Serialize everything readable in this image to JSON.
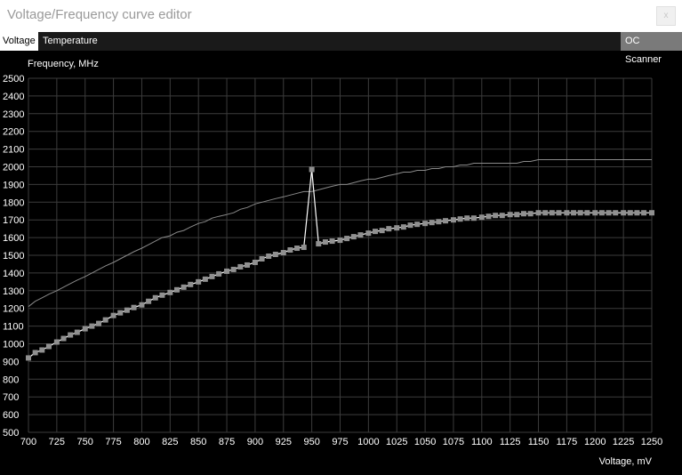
{
  "window": {
    "title": "Voltage/Frequency curve editor",
    "close_glyph": "x"
  },
  "tabs": {
    "voltage": "Voltage",
    "temperature": "Temperature",
    "oc_scanner": "OC Scanner"
  },
  "colors": {
    "background": "#000000",
    "grid": "#3c3c3c",
    "curve": "#ffffff",
    "reference_curve": "#8a8a8a",
    "point": "#909090"
  },
  "chart_data": {
    "type": "line",
    "ylabel": "Frequency, MHz",
    "xlabel": "Voltage, mV",
    "xlim": [
      700,
      1250
    ],
    "ylim": [
      500,
      2500
    ],
    "xticks": [
      700,
      725,
      750,
      775,
      800,
      825,
      850,
      875,
      900,
      925,
      950,
      975,
      1000,
      1025,
      1050,
      1075,
      1100,
      1125,
      1150,
      1175,
      1200,
      1225,
      1250
    ],
    "yticks": [
      500,
      600,
      700,
      800,
      900,
      1000,
      1100,
      1200,
      1300,
      1400,
      1500,
      1600,
      1700,
      1800,
      1900,
      2000,
      2100,
      2200,
      2300,
      2400,
      2500
    ],
    "grid": true,
    "series": [
      {
        "role": "reference",
        "x": [
          700,
          706,
          712,
          718,
          725,
          731,
          737,
          743,
          750,
          756,
          762,
          768,
          775,
          781,
          787,
          793,
          800,
          806,
          812,
          818,
          825,
          831,
          837,
          843,
          850,
          856,
          862,
          868,
          875,
          881,
          887,
          893,
          900,
          906,
          912,
          918,
          925,
          931,
          937,
          943,
          950,
          956,
          962,
          968,
          975,
          981,
          987,
          993,
          1000,
          1006,
          1012,
          1018,
          1025,
          1031,
          1037,
          1043,
          1050,
          1056,
          1062,
          1068,
          1075,
          1081,
          1087,
          1093,
          1100,
          1106,
          1112,
          1118,
          1125,
          1131,
          1137,
          1143,
          1150,
          1156,
          1162,
          1168,
          1175,
          1181,
          1187,
          1193,
          1200,
          1206,
          1212,
          1218,
          1225,
          1231,
          1237,
          1243,
          1250
        ],
        "y": [
          1210,
          1240,
          1260,
          1280,
          1300,
          1320,
          1340,
          1360,
          1380,
          1400,
          1420,
          1440,
          1460,
          1480,
          1500,
          1520,
          1540,
          1560,
          1580,
          1600,
          1610,
          1630,
          1640,
          1660,
          1680,
          1690,
          1710,
          1720,
          1730,
          1740,
          1760,
          1770,
          1790,
          1800,
          1810,
          1820,
          1830,
          1840,
          1850,
          1860,
          1860,
          1870,
          1880,
          1890,
          1900,
          1900,
          1910,
          1920,
          1930,
          1930,
          1940,
          1950,
          1960,
          1970,
          1970,
          1980,
          1980,
          1990,
          1990,
          2000,
          2000,
          2010,
          2010,
          2020,
          2020,
          2020,
          2020,
          2020,
          2020,
          2020,
          2030,
          2030,
          2040,
          2040,
          2040,
          2040,
          2040,
          2040,
          2040,
          2040,
          2040,
          2040,
          2040,
          2040,
          2040,
          2040,
          2040,
          2040,
          2040
        ]
      },
      {
        "role": "curve",
        "x": [
          700,
          706,
          712,
          718,
          725,
          731,
          737,
          743,
          750,
          756,
          762,
          768,
          775,
          781,
          787,
          793,
          800,
          806,
          812,
          818,
          825,
          831,
          837,
          843,
          850,
          856,
          862,
          868,
          875,
          881,
          887,
          893,
          900,
          906,
          912,
          918,
          925,
          931,
          937,
          943,
          950,
          956,
          962,
          968,
          975,
          981,
          987,
          993,
          1000,
          1006,
          1012,
          1018,
          1025,
          1031,
          1037,
          1043,
          1050,
          1056,
          1062,
          1068,
          1075,
          1081,
          1087,
          1093,
          1100,
          1106,
          1112,
          1118,
          1125,
          1131,
          1137,
          1143,
          1150,
          1156,
          1162,
          1168,
          1175,
          1181,
          1187,
          1193,
          1200,
          1206,
          1212,
          1218,
          1225,
          1231,
          1237,
          1243,
          1250
        ],
        "y": [
          920,
          950,
          965,
          985,
          1010,
          1030,
          1050,
          1065,
          1085,
          1100,
          1115,
          1135,
          1160,
          1175,
          1190,
          1205,
          1220,
          1240,
          1260,
          1275,
          1290,
          1305,
          1320,
          1335,
          1350,
          1365,
          1380,
          1395,
          1410,
          1420,
          1435,
          1445,
          1460,
          1480,
          1495,
          1505,
          1515,
          1530,
          1540,
          1545,
          1985,
          1565,
          1575,
          1580,
          1585,
          1595,
          1605,
          1615,
          1625,
          1635,
          1640,
          1650,
          1655,
          1660,
          1670,
          1675,
          1680,
          1685,
          1690,
          1695,
          1700,
          1705,
          1710,
          1710,
          1715,
          1720,
          1725,
          1725,
          1730,
          1730,
          1735,
          1735,
          1740,
          1740,
          1740,
          1740,
          1740,
          1740,
          1740,
          1740,
          1740,
          1740,
          1740,
          1740,
          1740,
          1740,
          1740,
          1740,
          1740
        ]
      }
    ]
  }
}
